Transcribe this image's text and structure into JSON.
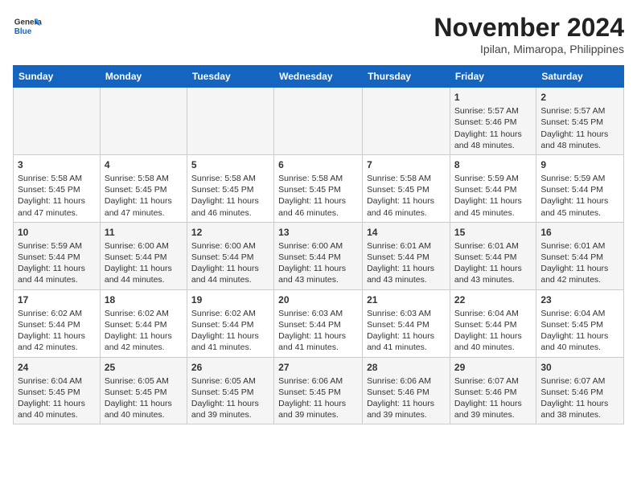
{
  "logo": {
    "line1": "General",
    "line2": "Blue"
  },
  "title": "November 2024",
  "location": "Ipilan, Mimaropa, Philippines",
  "days_of_week": [
    "Sunday",
    "Monday",
    "Tuesday",
    "Wednesday",
    "Thursday",
    "Friday",
    "Saturday"
  ],
  "weeks": [
    [
      {
        "day": "",
        "content": ""
      },
      {
        "day": "",
        "content": ""
      },
      {
        "day": "",
        "content": ""
      },
      {
        "day": "",
        "content": ""
      },
      {
        "day": "",
        "content": ""
      },
      {
        "day": "1",
        "content": "Sunrise: 5:57 AM\nSunset: 5:46 PM\nDaylight: 11 hours and 48 minutes."
      },
      {
        "day": "2",
        "content": "Sunrise: 5:57 AM\nSunset: 5:45 PM\nDaylight: 11 hours and 48 minutes."
      }
    ],
    [
      {
        "day": "3",
        "content": "Sunrise: 5:58 AM\nSunset: 5:45 PM\nDaylight: 11 hours and 47 minutes."
      },
      {
        "day": "4",
        "content": "Sunrise: 5:58 AM\nSunset: 5:45 PM\nDaylight: 11 hours and 47 minutes."
      },
      {
        "day": "5",
        "content": "Sunrise: 5:58 AM\nSunset: 5:45 PM\nDaylight: 11 hours and 46 minutes."
      },
      {
        "day": "6",
        "content": "Sunrise: 5:58 AM\nSunset: 5:45 PM\nDaylight: 11 hours and 46 minutes."
      },
      {
        "day": "7",
        "content": "Sunrise: 5:58 AM\nSunset: 5:45 PM\nDaylight: 11 hours and 46 minutes."
      },
      {
        "day": "8",
        "content": "Sunrise: 5:59 AM\nSunset: 5:44 PM\nDaylight: 11 hours and 45 minutes."
      },
      {
        "day": "9",
        "content": "Sunrise: 5:59 AM\nSunset: 5:44 PM\nDaylight: 11 hours and 45 minutes."
      }
    ],
    [
      {
        "day": "10",
        "content": "Sunrise: 5:59 AM\nSunset: 5:44 PM\nDaylight: 11 hours and 44 minutes."
      },
      {
        "day": "11",
        "content": "Sunrise: 6:00 AM\nSunset: 5:44 PM\nDaylight: 11 hours and 44 minutes."
      },
      {
        "day": "12",
        "content": "Sunrise: 6:00 AM\nSunset: 5:44 PM\nDaylight: 11 hours and 44 minutes."
      },
      {
        "day": "13",
        "content": "Sunrise: 6:00 AM\nSunset: 5:44 PM\nDaylight: 11 hours and 43 minutes."
      },
      {
        "day": "14",
        "content": "Sunrise: 6:01 AM\nSunset: 5:44 PM\nDaylight: 11 hours and 43 minutes."
      },
      {
        "day": "15",
        "content": "Sunrise: 6:01 AM\nSunset: 5:44 PM\nDaylight: 11 hours and 43 minutes."
      },
      {
        "day": "16",
        "content": "Sunrise: 6:01 AM\nSunset: 5:44 PM\nDaylight: 11 hours and 42 minutes."
      }
    ],
    [
      {
        "day": "17",
        "content": "Sunrise: 6:02 AM\nSunset: 5:44 PM\nDaylight: 11 hours and 42 minutes."
      },
      {
        "day": "18",
        "content": "Sunrise: 6:02 AM\nSunset: 5:44 PM\nDaylight: 11 hours and 42 minutes."
      },
      {
        "day": "19",
        "content": "Sunrise: 6:02 AM\nSunset: 5:44 PM\nDaylight: 11 hours and 41 minutes."
      },
      {
        "day": "20",
        "content": "Sunrise: 6:03 AM\nSunset: 5:44 PM\nDaylight: 11 hours and 41 minutes."
      },
      {
        "day": "21",
        "content": "Sunrise: 6:03 AM\nSunset: 5:44 PM\nDaylight: 11 hours and 41 minutes."
      },
      {
        "day": "22",
        "content": "Sunrise: 6:04 AM\nSunset: 5:44 PM\nDaylight: 11 hours and 40 minutes."
      },
      {
        "day": "23",
        "content": "Sunrise: 6:04 AM\nSunset: 5:45 PM\nDaylight: 11 hours and 40 minutes."
      }
    ],
    [
      {
        "day": "24",
        "content": "Sunrise: 6:04 AM\nSunset: 5:45 PM\nDaylight: 11 hours and 40 minutes."
      },
      {
        "day": "25",
        "content": "Sunrise: 6:05 AM\nSunset: 5:45 PM\nDaylight: 11 hours and 40 minutes."
      },
      {
        "day": "26",
        "content": "Sunrise: 6:05 AM\nSunset: 5:45 PM\nDaylight: 11 hours and 39 minutes."
      },
      {
        "day": "27",
        "content": "Sunrise: 6:06 AM\nSunset: 5:45 PM\nDaylight: 11 hours and 39 minutes."
      },
      {
        "day": "28",
        "content": "Sunrise: 6:06 AM\nSunset: 5:46 PM\nDaylight: 11 hours and 39 minutes."
      },
      {
        "day": "29",
        "content": "Sunrise: 6:07 AM\nSunset: 5:46 PM\nDaylight: 11 hours and 39 minutes."
      },
      {
        "day": "30",
        "content": "Sunrise: 6:07 AM\nSunset: 5:46 PM\nDaylight: 11 hours and 38 minutes."
      }
    ]
  ]
}
